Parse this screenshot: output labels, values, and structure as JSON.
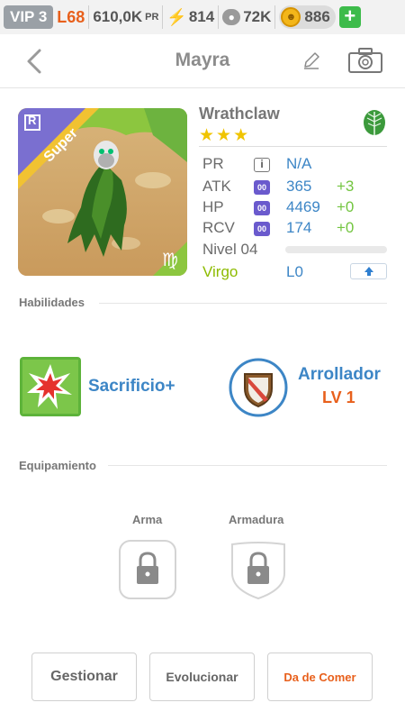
{
  "status": {
    "vip": "VIP 3",
    "level": "L68",
    "pr_value": "610,0K",
    "pr_unit": "PR",
    "energy": "814",
    "paw_count": "72K",
    "coins": "886",
    "plus_label": "+"
  },
  "header": {
    "title": "Mayra",
    "back_icon": "chevron-left",
    "edit_icon": "pencil",
    "camera_icon": "camera"
  },
  "card": {
    "rarity_badge": "R",
    "tier": "Super",
    "zodiac_symbol": "♍"
  },
  "monster": {
    "name": "Wrathclaw",
    "stars": "★★★",
    "star_count": 3,
    "element_icon": "leaf",
    "stats": {
      "pr_label": "PR",
      "pr_icon_text": "i",
      "pr_value": "N/A",
      "atk_label": "ATK",
      "atk_value": "365",
      "atk_bonus": "+3",
      "hp_label": "HP",
      "hp_value": "4469",
      "hp_bonus": "+0",
      "rcv_label": "RCV",
      "rcv_value": "174",
      "rcv_bonus": "+0",
      "gem_text": "00"
    },
    "level_label": "Nivel 04",
    "level_progress": 0,
    "sign": "Virgo",
    "rank": "L0"
  },
  "skills": {
    "section_title": "Habilidades",
    "active_name": "Sacrificio+",
    "leader_name": "Arrollador",
    "leader_level": "LV 1"
  },
  "equipment": {
    "section_title": "Equipamiento",
    "weapon_label": "Arma",
    "armor_label": "Armadura"
  },
  "actions": {
    "manage": "Gestionar",
    "evolve": "Evolucionar",
    "feed": "Da de Comer"
  },
  "colors": {
    "accent_blue": "#3d86c6",
    "accent_orange": "#e8601c",
    "bonus_green": "#73c540",
    "virgo_green": "#8dbb00",
    "star_yellow": "#f0c400"
  }
}
